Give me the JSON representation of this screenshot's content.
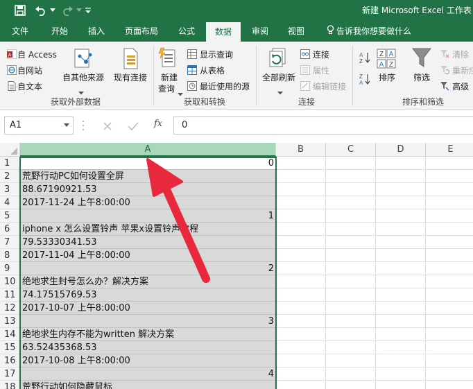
{
  "window": {
    "title": "新建 Microsoft Excel 工作表"
  },
  "colors": {
    "accent": "#217346",
    "selection": "#d9d9d9",
    "arrow": "#e8283c"
  },
  "tabs": [
    "文件",
    "开始",
    "插入",
    "页面布局",
    "公式",
    "数据",
    "审阅",
    "视图"
  ],
  "active_tab": "数据",
  "tell_me": "告诉我你想要做什么",
  "ribbon": {
    "get_external": {
      "access": "自 Access",
      "web": "自网站",
      "text": "自文本",
      "other": "自其他来源",
      "existing": "现有连接",
      "label": "获取外部数据"
    },
    "get_transform": {
      "new_query_1": "新建",
      "new_query_2": "查询",
      "show_queries": "显示查询",
      "from_table": "从表格",
      "recent_sources": "最近使用的源",
      "label": "获取和转换"
    },
    "connections": {
      "refresh_all": "全部刷新",
      "connections": "连接",
      "properties": "属性",
      "edit_links": "编辑链接",
      "label": "连接"
    },
    "sort_filter": {
      "sort": "排序",
      "filter": "筛选",
      "clear": "清除",
      "reapply": "重新应",
      "advanced": "高级",
      "label": "排序和筛选"
    }
  },
  "formula_bar": {
    "name_box": "A1",
    "fx": "fx",
    "value": "0"
  },
  "columns": [
    "A",
    "B",
    "C",
    "D",
    "E"
  ],
  "rows": [
    {
      "num": "1",
      "value": "0",
      "align": "right"
    },
    {
      "num": "2",
      "value": "荒野行动PC如何设置全屏",
      "align": "left"
    },
    {
      "num": "3",
      "value": "88.67190921.53",
      "align": "left"
    },
    {
      "num": "4",
      "value": "2017-11-24 上午8:00:00",
      "align": "left"
    },
    {
      "num": "5",
      "value": "1",
      "align": "right"
    },
    {
      "num": "6",
      "value": "iphone x 怎么设置铃声 苹果x设置铃声教程",
      "align": "left"
    },
    {
      "num": "7",
      "value": "79.53330341.53",
      "align": "left"
    },
    {
      "num": "8",
      "value": "2017-11-04 上午8:00:00",
      "align": "left"
    },
    {
      "num": "9",
      "value": "2",
      "align": "right"
    },
    {
      "num": "10",
      "value": "绝地求生封号怎么办？解决方案",
      "align": "left"
    },
    {
      "num": "11",
      "value": "74.17515769.53",
      "align": "left"
    },
    {
      "num": "12",
      "value": "2017-10-07 上午8:00:00",
      "align": "left"
    },
    {
      "num": "13",
      "value": "3",
      "align": "right"
    },
    {
      "num": "14",
      "value": "绝地求生内存不能为written 解决方案",
      "align": "left"
    },
    {
      "num": "15",
      "value": "63.52435368.53",
      "align": "left"
    },
    {
      "num": "16",
      "value": "2017-10-08 上午8:00:00",
      "align": "left"
    },
    {
      "num": "17",
      "value": "4",
      "align": "right"
    },
    {
      "num": "18",
      "value": "荒野行动如何隐藏鼠标",
      "align": "left"
    }
  ]
}
